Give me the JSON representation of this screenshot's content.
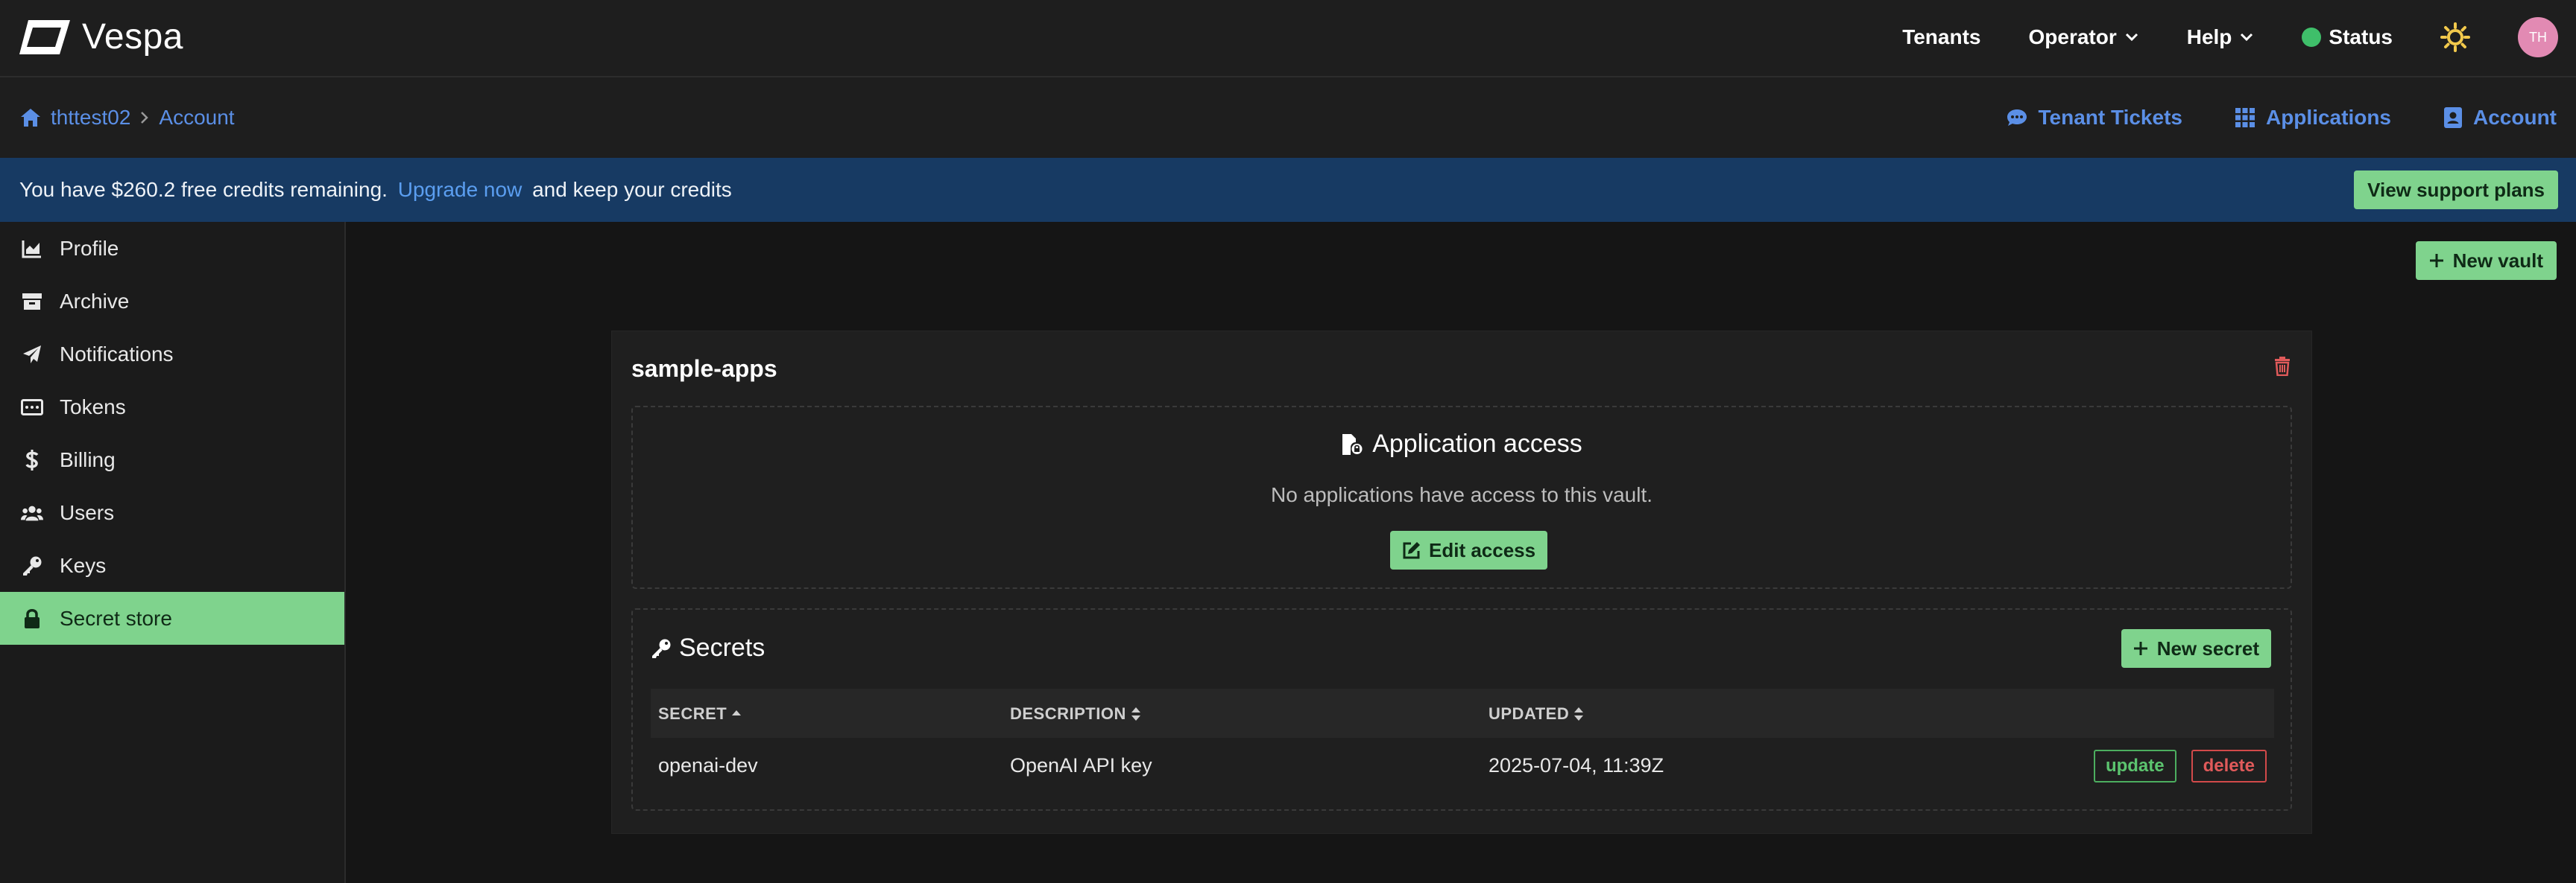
{
  "header": {
    "logo_text": "Vespa",
    "nav": {
      "tenants": "Tenants",
      "operator": "Operator",
      "help": "Help",
      "status": "Status"
    },
    "avatar_initials": "TH",
    "status_color": "#3fbf6a",
    "avatar_color": "#e28ab3"
  },
  "breadcrumb": {
    "tenant": "thttest02",
    "page": "Account"
  },
  "sublinks": {
    "tenant_tickets": "Tenant Tickets",
    "applications": "Applications",
    "account": "Account"
  },
  "banner": {
    "text_before": "You have $260.2 free credits remaining.",
    "link": "Upgrade now",
    "text_after": "and keep your credits",
    "button": "View support plans"
  },
  "sidebar": {
    "items": [
      {
        "label": "Profile",
        "icon": "chart-icon"
      },
      {
        "label": "Archive",
        "icon": "archive-icon"
      },
      {
        "label": "Notifications",
        "icon": "paper-plane-icon"
      },
      {
        "label": "Tokens",
        "icon": "token-icon"
      },
      {
        "label": "Billing",
        "icon": "dollar-icon"
      },
      {
        "label": "Users",
        "icon": "users-icon"
      },
      {
        "label": "Keys",
        "icon": "key-icon"
      },
      {
        "label": "Secret store",
        "icon": "lock-icon",
        "active": true
      }
    ]
  },
  "main": {
    "new_vault": "New vault",
    "vault": {
      "name": "sample-apps",
      "access": {
        "title": "Application access",
        "message": "No applications have access to this vault.",
        "edit_button": "Edit access"
      },
      "secrets": {
        "title": "Secrets",
        "new_button": "New secret",
        "columns": [
          "SECRET",
          "DESCRIPTION",
          "UPDATED"
        ],
        "rows": [
          {
            "secret": "openai-dev",
            "description": "OpenAI API key",
            "updated": "2025-07-04, 11:39Z",
            "update_label": "update",
            "delete_label": "delete"
          }
        ]
      }
    }
  },
  "colors": {
    "accent_green": "#7fd38d",
    "link_blue": "#5b8fe6",
    "banner_blue": "#173a63",
    "danger_red": "#e05a5a"
  }
}
